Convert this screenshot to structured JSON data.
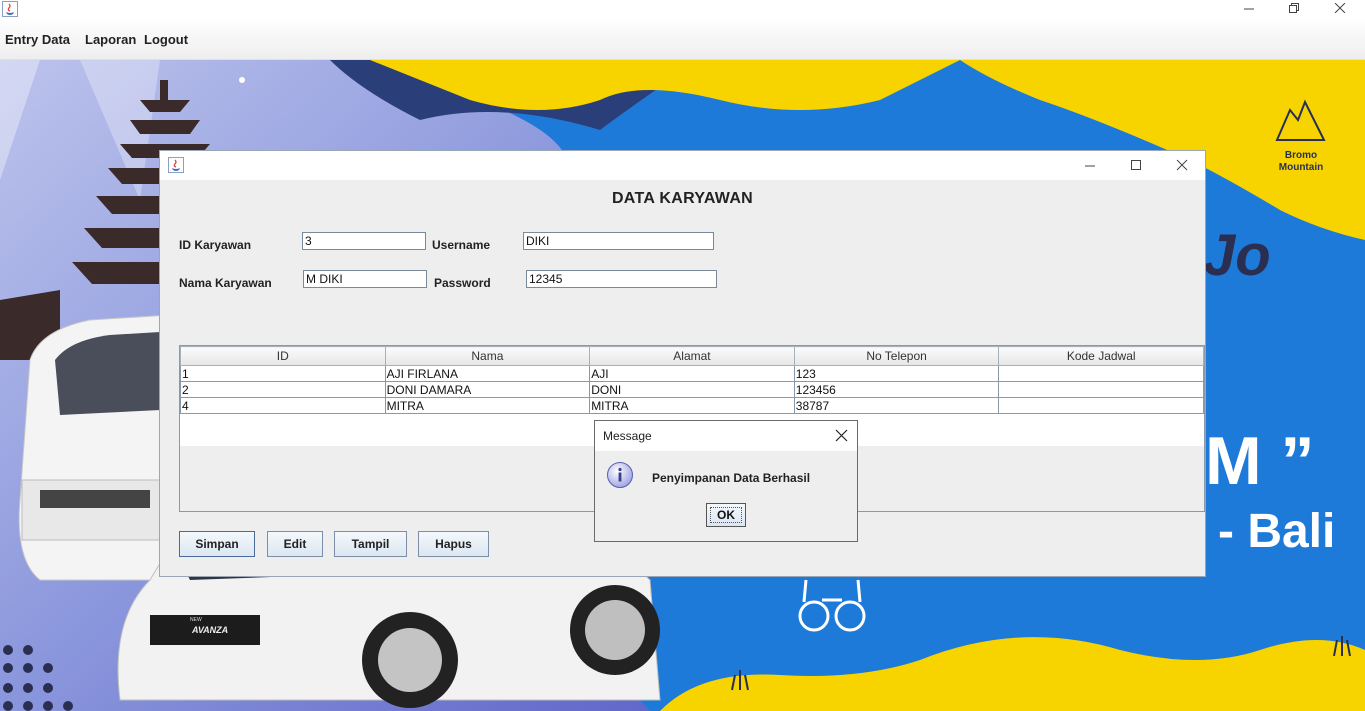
{
  "menu": {
    "items": [
      "Entry Data",
      "Laporan",
      "Logout"
    ]
  },
  "form": {
    "title": "DATA KARYAWAN",
    "id_label": "ID Karyawan",
    "id_value": "3",
    "username_label": "Username",
    "username_value": "DIKI",
    "nama_label": "Nama Karyawan",
    "nama_value": "M DIKI",
    "password_label": "Password",
    "password_value": "12345"
  },
  "table": {
    "columns": [
      "ID",
      "Nama",
      "Alamat",
      "No Telepon",
      "Kode Jadwal"
    ],
    "rows": [
      [
        "1",
        "AJI FIRLANA",
        "AJI",
        "123",
        ""
      ],
      [
        "2",
        "DONI DAMARA",
        "DONI",
        "123456",
        ""
      ],
      [
        "4",
        "MITRA",
        "MITRA",
        "38787",
        ""
      ]
    ]
  },
  "buttons": {
    "simpan": "Simpan",
    "edit": "Edit",
    "tampil": "Tampil",
    "hapus": "Hapus"
  },
  "dialog": {
    "title": "Message",
    "message": "Penyimpanan Data Berhasil",
    "ok": "OK",
    "icon": "info-icon"
  },
  "background": {
    "logo_line1": "Bromo",
    "logo_line2": "Mountain",
    "car_badge": "AVANZA",
    "car_badge_small": "NEW",
    "text_fragment1": "Jo",
    "text_fragment2": "M ”",
    "text_fragment3": "- Bali"
  },
  "colors": {
    "bg_blue": "#1e7ad8",
    "bg_yellow": "#f7d400",
    "bg_navy": "#2a3f7a"
  }
}
